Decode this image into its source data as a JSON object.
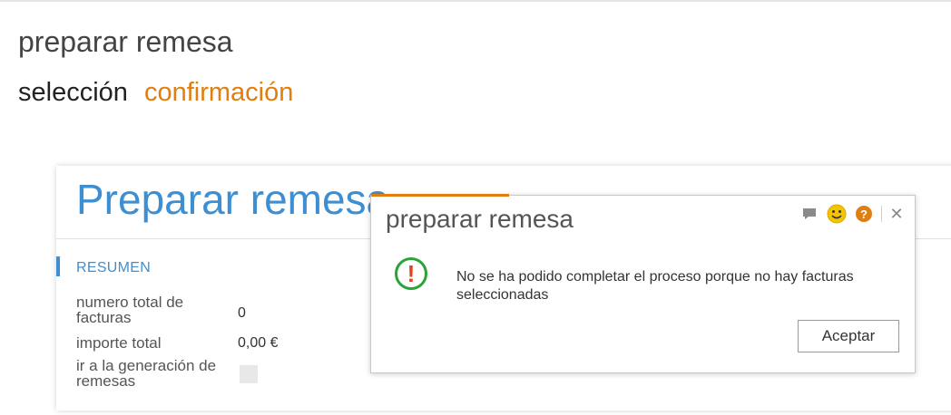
{
  "page": {
    "title": "preparar remesa",
    "steps": {
      "current": "selección",
      "next": "confirmación"
    }
  },
  "card": {
    "title": "Preparar remesa",
    "section_title": "RESUMEN",
    "rows": [
      {
        "label": "numero total de facturas",
        "value": "0"
      },
      {
        "label": "importe total",
        "value": "0,00 €"
      },
      {
        "label": "ir a la generación de remesas",
        "checked": false
      }
    ]
  },
  "dialog": {
    "title": "preparar remesa",
    "icons": [
      "chat-icon",
      "smiley-icon",
      "help-icon",
      "close-icon"
    ],
    "help_glyph": "?",
    "close_glyph": "✕",
    "warning_glyph": "!",
    "message": "No se ha podido completar el proceso porque no hay facturas seleccionadas",
    "ok_label": "Aceptar"
  },
  "colors": {
    "accent_orange": "#e07e10",
    "title_blue": "#3e8fd2",
    "warning_green": "#2aa339",
    "warning_red": "#e0431b"
  }
}
